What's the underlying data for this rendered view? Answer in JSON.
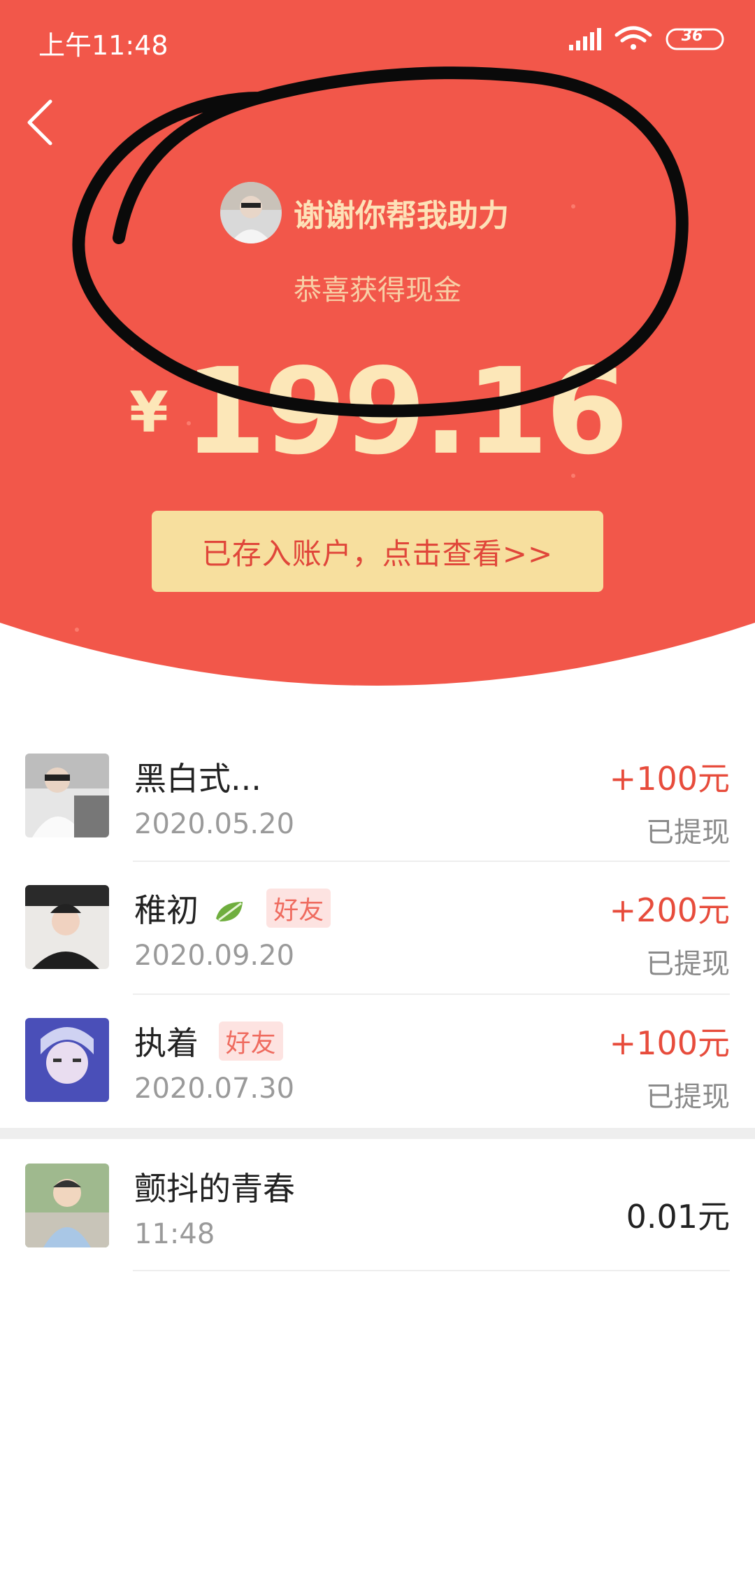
{
  "status_bar": {
    "time": "上午11:48",
    "battery": "36"
  },
  "hero": {
    "thanks": "谢谢你帮我助力",
    "congrats": "恭喜获得现金",
    "currency": "¥",
    "amount": "199.16",
    "button_label": "已存入账户，点击查看>>"
  },
  "records": [
    {
      "name": "黑白式...",
      "date": "2020.05.20",
      "amount": "+100元",
      "status": "已提现",
      "tag": ""
    },
    {
      "name": "稚初",
      "date": "2020.09.20",
      "amount": "+200元",
      "status": "已提现",
      "tag": "好友"
    },
    {
      "name": "执着",
      "date": "2020.07.30",
      "amount": "+100元",
      "status": "已提现",
      "tag": "好友"
    }
  ],
  "my_record": {
    "name": "颤抖的青春",
    "time": "11:48",
    "amount": "0.01元"
  },
  "colors": {
    "hero_red": "#f2574a",
    "button_yellow": "#f7df9e",
    "amount_red": "#e74c3c"
  }
}
